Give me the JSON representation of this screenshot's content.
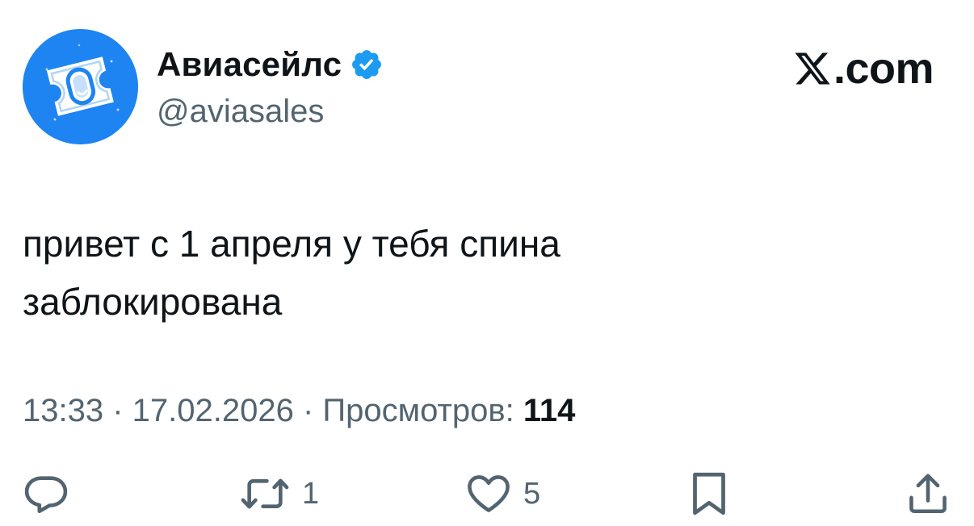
{
  "author": {
    "display_name": "Авиасейлс",
    "handle": "@aviasales",
    "verified": true,
    "avatar_icon": "aviasales-ticket-icon",
    "avatar_color": "#1d84f1"
  },
  "brand": {
    "icon": "x-logo-icon",
    "text": ".com"
  },
  "tweet": {
    "text": "привет с 1 апреля у тебя спина\nзаблокирована"
  },
  "meta": {
    "time": "13:33",
    "separator": " · ",
    "date": "17.02.2026",
    "views_label": "Просмотров:",
    "views_count": "114"
  },
  "actions": {
    "reply": {
      "icon": "reply-bubble-icon",
      "count": ""
    },
    "retweet": {
      "icon": "retweet-icon",
      "count": "1"
    },
    "like": {
      "icon": "heart-icon",
      "count": "5"
    },
    "bookmark": {
      "icon": "bookmark-icon",
      "count": ""
    },
    "share": {
      "icon": "share-icon",
      "count": ""
    }
  },
  "colors": {
    "text_primary": "#0f1419",
    "text_secondary": "#536471",
    "verified_blue": "#1d9bf0"
  }
}
